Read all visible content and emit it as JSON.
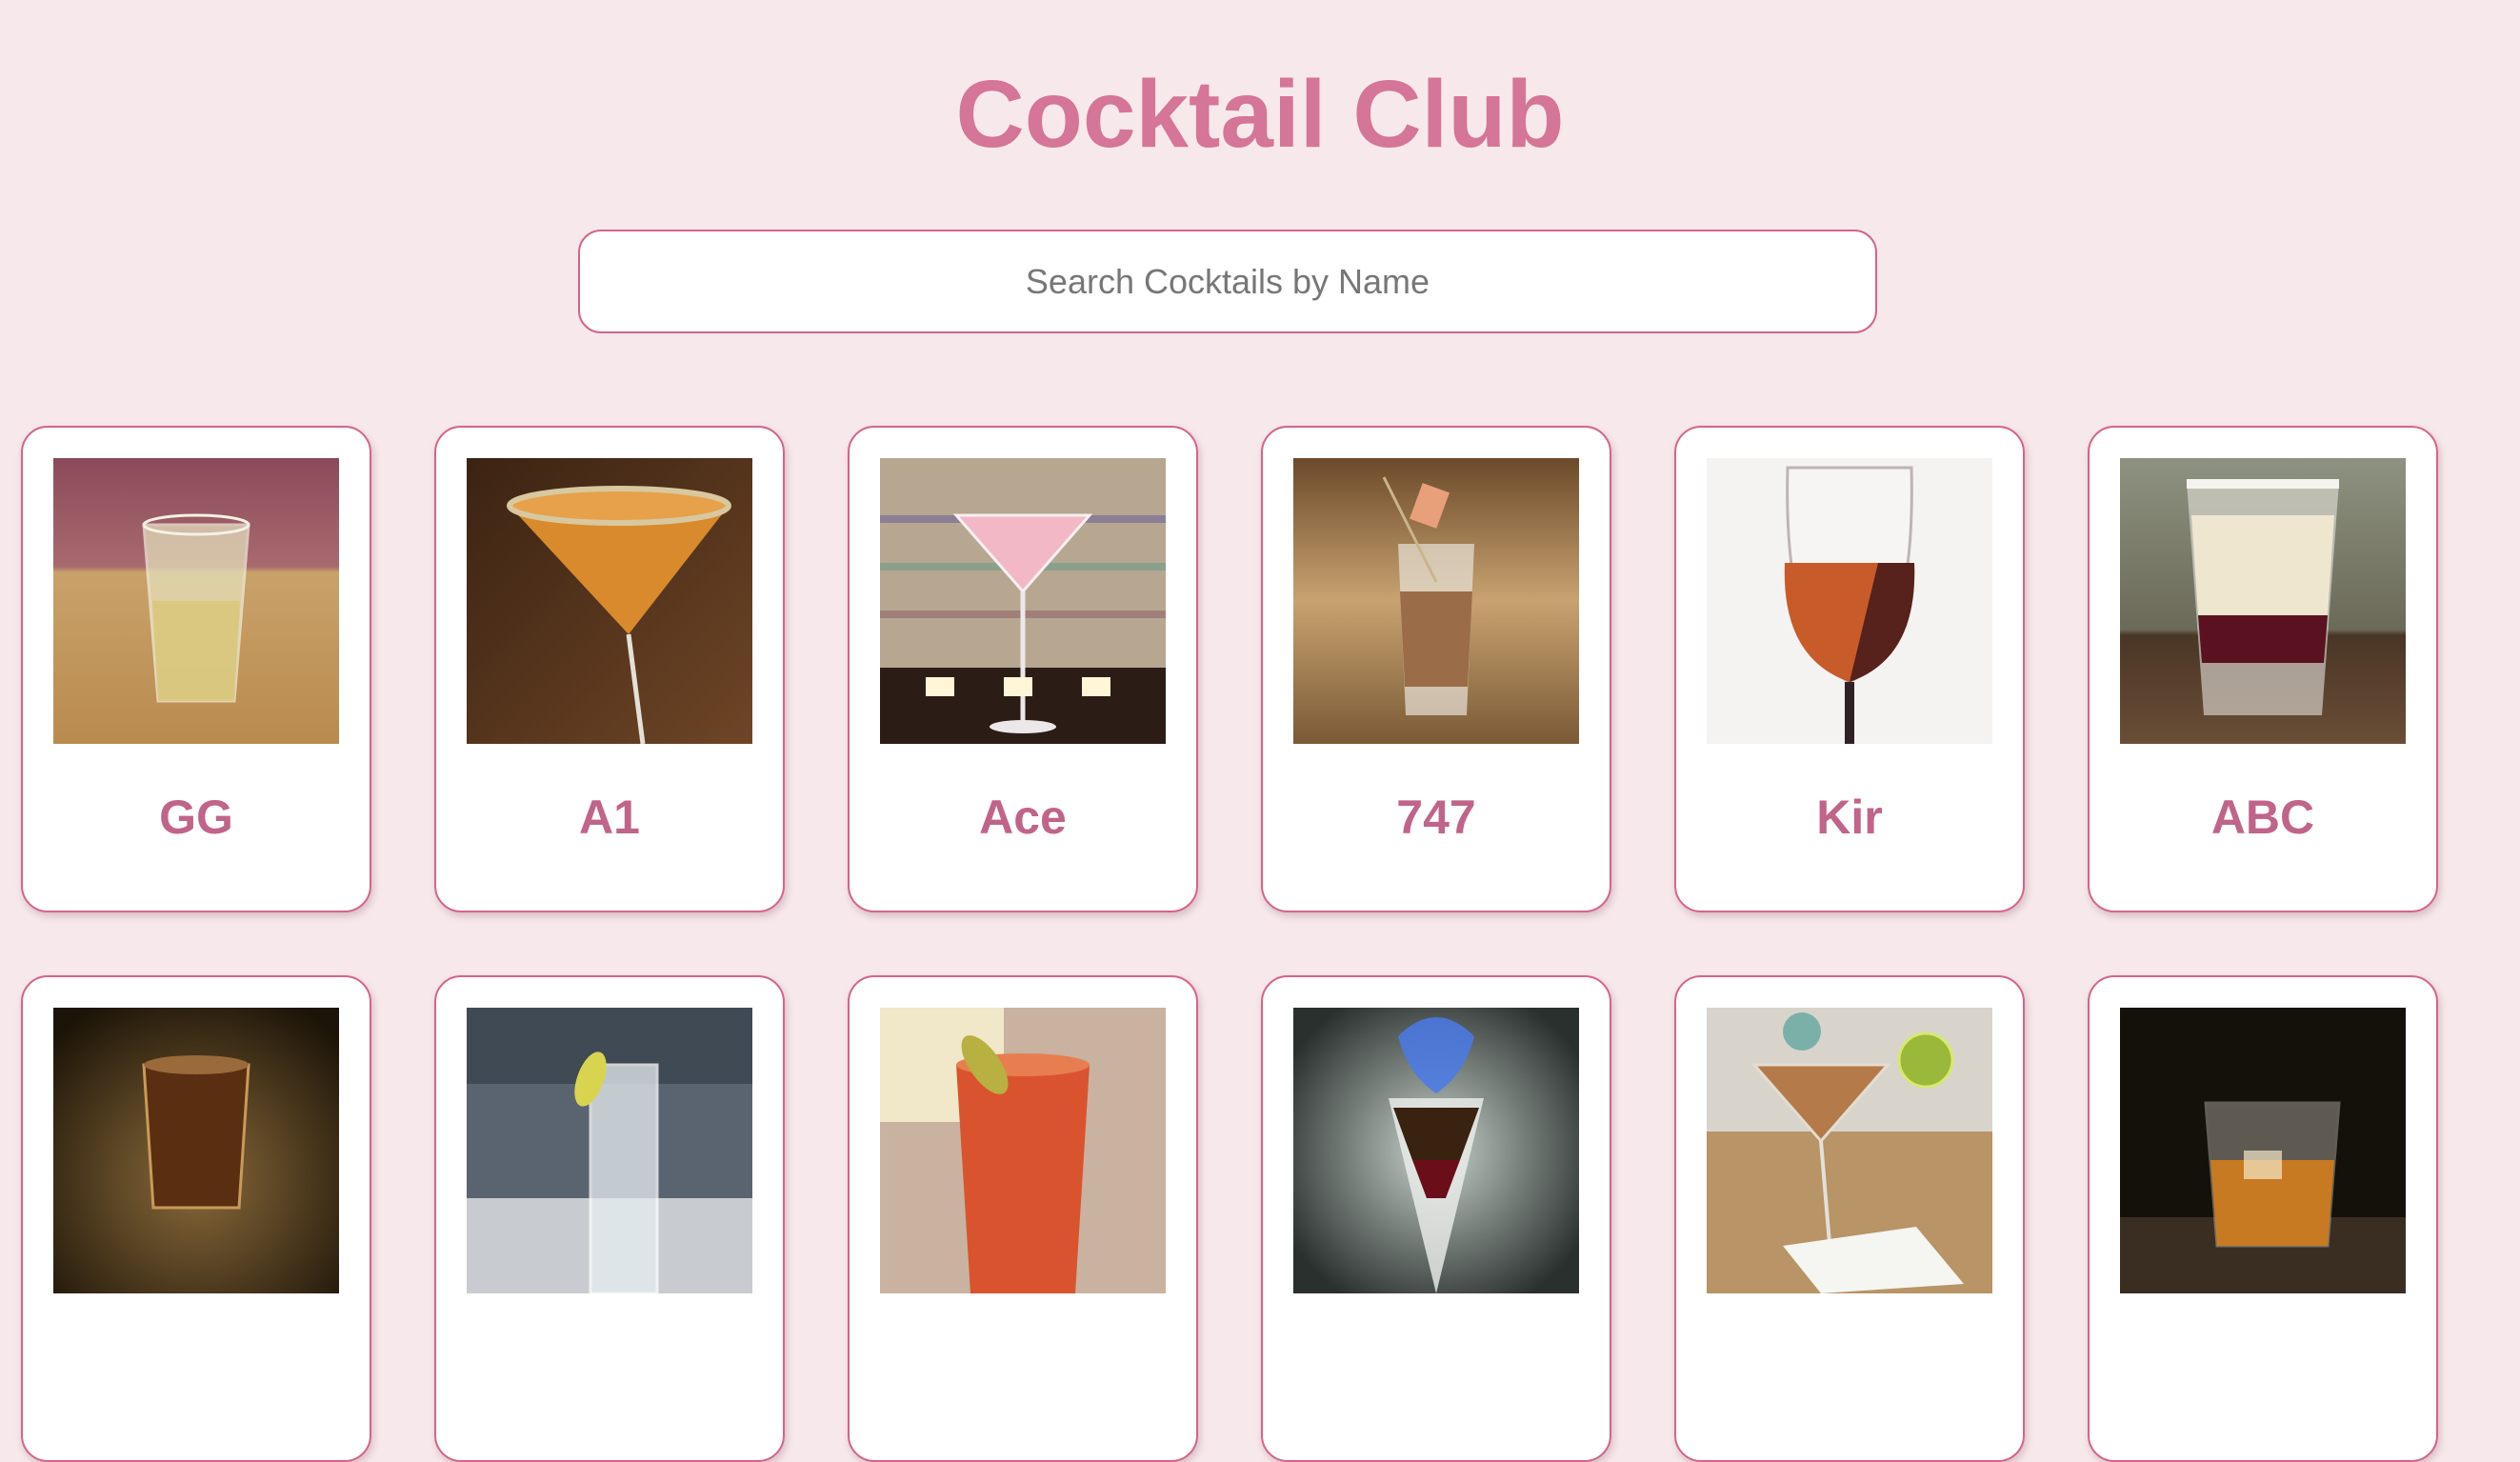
{
  "header": {
    "title": "Cocktail Club"
  },
  "search": {
    "placeholder": "Search Cocktails by Name",
    "value": ""
  },
  "cocktails": [
    {
      "name": "GG",
      "icon": "rocks-glass-icon"
    },
    {
      "name": "A1",
      "icon": "martini-glass-icon"
    },
    {
      "name": "Ace",
      "icon": "martini-glass-icon"
    },
    {
      "name": "747",
      "icon": "shot-glass-icon"
    },
    {
      "name": "Kir",
      "icon": "wine-glass-icon"
    },
    {
      "name": "ABC",
      "icon": "shot-glass-icon"
    },
    {
      "name": "",
      "icon": "shot-glass-icon"
    },
    {
      "name": "",
      "icon": "highball-glass-icon"
    },
    {
      "name": "",
      "icon": "rocks-glass-icon"
    },
    {
      "name": "",
      "icon": "flaming-shot-icon"
    },
    {
      "name": "",
      "icon": "martini-glass-icon"
    },
    {
      "name": "",
      "icon": "rocks-glass-icon"
    }
  ],
  "colors": {
    "background": "#f7e9eb",
    "accent": "#d57597",
    "border": "#d5638c",
    "card_title": "#c0648a"
  }
}
